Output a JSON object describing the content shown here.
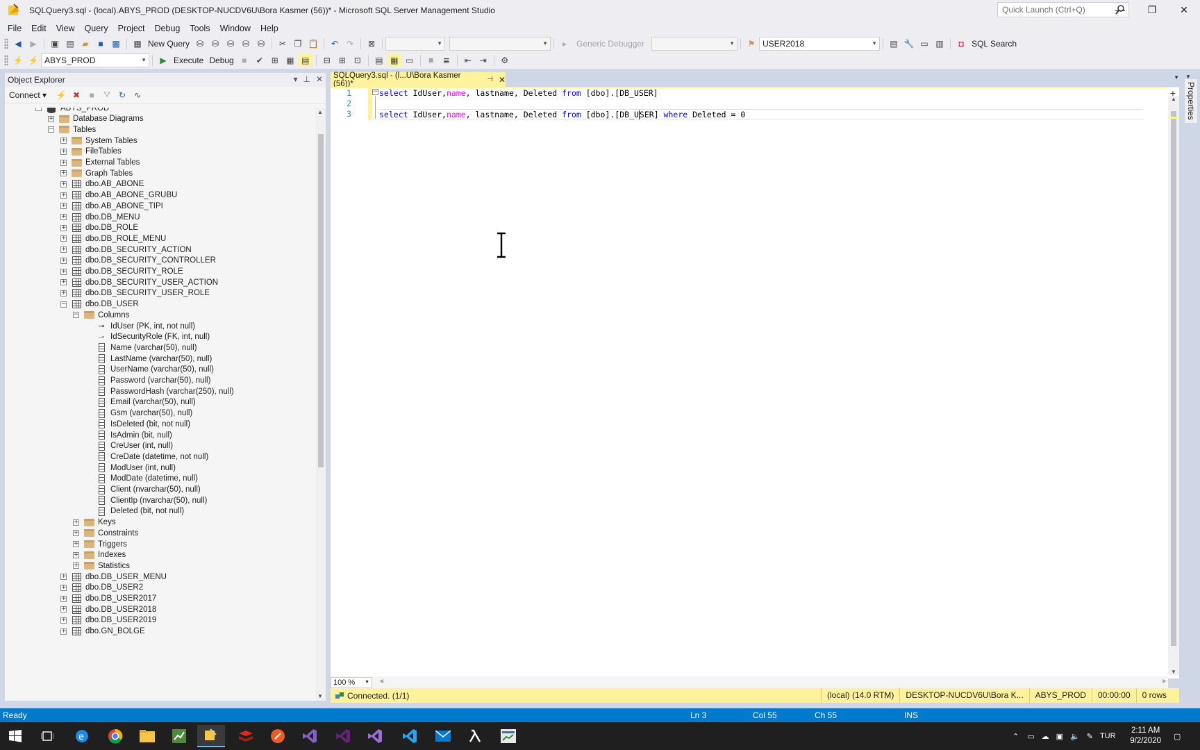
{
  "window": {
    "title": "SQLQuery3.sql - (local).ABYS_PROD (DESKTOP-NUCDV6U\\Bora Kasmer (56))* - Microsoft SQL Server Management Studio",
    "quick_launch_placeholder": "Quick Launch (Ctrl+Q)",
    "minimize": "—",
    "maximize": "❐",
    "close": "✕"
  },
  "menu": [
    "File",
    "Edit",
    "View",
    "Query",
    "Project",
    "Debug",
    "Tools",
    "Window",
    "Help"
  ],
  "toolbar1": {
    "new_query": "New Query",
    "debugger": "Generic Debugger",
    "server_combo": "USER2018",
    "sql_search": "SQL Search"
  },
  "toolbar2": {
    "database": "ABYS_PROD",
    "execute": "Execute",
    "debug": "Debug"
  },
  "object_explorer": {
    "title": "Object Explorer",
    "connect": "Connect",
    "tree": [
      {
        "label": "ABYS_PROD",
        "depth": 2,
        "icon": "database",
        "expander": "-"
      },
      {
        "label": "Database Diagrams",
        "depth": 3,
        "icon": "folder",
        "expander": "+"
      },
      {
        "label": "Tables",
        "depth": 3,
        "icon": "folder",
        "expander": "-"
      },
      {
        "label": "System Tables",
        "depth": 4,
        "icon": "folder",
        "expander": "+"
      },
      {
        "label": "FileTables",
        "depth": 4,
        "icon": "folder",
        "expander": "+"
      },
      {
        "label": "External Tables",
        "depth": 4,
        "icon": "folder",
        "expander": "+"
      },
      {
        "label": "Graph Tables",
        "depth": 4,
        "icon": "folder",
        "expander": "+"
      },
      {
        "label": "dbo.AB_ABONE",
        "depth": 4,
        "icon": "table",
        "expander": "+"
      },
      {
        "label": "dbo.AB_ABONE_GRUBU",
        "depth": 4,
        "icon": "table",
        "expander": "+"
      },
      {
        "label": "dbo.AB_ABONE_TIPI",
        "depth": 4,
        "icon": "table",
        "expander": "+"
      },
      {
        "label": "dbo.DB_MENU",
        "depth": 4,
        "icon": "table",
        "expander": "+"
      },
      {
        "label": "dbo.DB_ROLE",
        "depth": 4,
        "icon": "table",
        "expander": "+"
      },
      {
        "label": "dbo.DB_ROLE_MENU",
        "depth": 4,
        "icon": "table",
        "expander": "+"
      },
      {
        "label": "dbo.DB_SECURITY_ACTION",
        "depth": 4,
        "icon": "table",
        "expander": "+"
      },
      {
        "label": "dbo.DB_SECURITY_CONTROLLER",
        "depth": 4,
        "icon": "table",
        "expander": "+"
      },
      {
        "label": "dbo.DB_SECURITY_ROLE",
        "depth": 4,
        "icon": "table",
        "expander": "+"
      },
      {
        "label": "dbo.DB_SECURITY_USER_ACTION",
        "depth": 4,
        "icon": "table",
        "expander": "+"
      },
      {
        "label": "dbo.DB_SECURITY_USER_ROLE",
        "depth": 4,
        "icon": "table",
        "expander": "+"
      },
      {
        "label": "dbo.DB_USER",
        "depth": 4,
        "icon": "table",
        "expander": "-"
      },
      {
        "label": "Columns",
        "depth": 5,
        "icon": "folder",
        "expander": "-"
      },
      {
        "label": "IdUser (PK, int, not null)",
        "depth": 6,
        "icon": "pk",
        "expander": ""
      },
      {
        "label": "IdSecurityRole (FK, int, null)",
        "depth": 6,
        "icon": "fk",
        "expander": ""
      },
      {
        "label": "Name (varchar(50), null)",
        "depth": 6,
        "icon": "column",
        "expander": ""
      },
      {
        "label": "LastName (varchar(50), null)",
        "depth": 6,
        "icon": "column",
        "expander": ""
      },
      {
        "label": "UserName (varchar(50), null)",
        "depth": 6,
        "icon": "column",
        "expander": ""
      },
      {
        "label": "Password (varchar(50), null)",
        "depth": 6,
        "icon": "column",
        "expander": ""
      },
      {
        "label": "PasswordHash (varchar(250), null)",
        "depth": 6,
        "icon": "column",
        "expander": ""
      },
      {
        "label": "Email (varchar(50), null)",
        "depth": 6,
        "icon": "column",
        "expander": ""
      },
      {
        "label": "Gsm (varchar(50), null)",
        "depth": 6,
        "icon": "column",
        "expander": ""
      },
      {
        "label": "IsDeleted (bit, not null)",
        "depth": 6,
        "icon": "column",
        "expander": ""
      },
      {
        "label": "IsAdmin (bit, null)",
        "depth": 6,
        "icon": "column",
        "expander": ""
      },
      {
        "label": "CreUser (int, null)",
        "depth": 6,
        "icon": "column",
        "expander": ""
      },
      {
        "label": "CreDate (datetime, not null)",
        "depth": 6,
        "icon": "column",
        "expander": ""
      },
      {
        "label": "ModUser (int, null)",
        "depth": 6,
        "icon": "column",
        "expander": ""
      },
      {
        "label": "ModDate (datetime, null)",
        "depth": 6,
        "icon": "column",
        "expander": ""
      },
      {
        "label": "Client (nvarchar(50), null)",
        "depth": 6,
        "icon": "column",
        "expander": ""
      },
      {
        "label": "ClientIp (nvarchar(50), null)",
        "depth": 6,
        "icon": "column",
        "expander": ""
      },
      {
        "label": "Deleted (bit, not null)",
        "depth": 6,
        "icon": "column",
        "expander": ""
      },
      {
        "label": "Keys",
        "depth": 5,
        "icon": "folder",
        "expander": "+"
      },
      {
        "label": "Constraints",
        "depth": 5,
        "icon": "folder",
        "expander": "+"
      },
      {
        "label": "Triggers",
        "depth": 5,
        "icon": "folder",
        "expander": "+"
      },
      {
        "label": "Indexes",
        "depth": 5,
        "icon": "folder",
        "expander": "+"
      },
      {
        "label": "Statistics",
        "depth": 5,
        "icon": "folder",
        "expander": "+"
      },
      {
        "label": "dbo.DB_USER_MENU",
        "depth": 4,
        "icon": "table",
        "expander": "+"
      },
      {
        "label": "dbo.DB_USER2",
        "depth": 4,
        "icon": "table",
        "expander": "+"
      },
      {
        "label": "dbo.DB_USER2017",
        "depth": 4,
        "icon": "table",
        "expander": "+"
      },
      {
        "label": "dbo.DB_USER2018",
        "depth": 4,
        "icon": "table",
        "expander": "+"
      },
      {
        "label": "dbo.DB_USER2019",
        "depth": 4,
        "icon": "table",
        "expander": "+"
      },
      {
        "label": "dbo.GN_BOLGE",
        "depth": 4,
        "icon": "table",
        "expander": "+"
      }
    ]
  },
  "document_tab": {
    "label": "SQLQuery3.sql - (l...U\\Bora Kasmer (56))*"
  },
  "editor": {
    "line_numbers": [
      "1",
      "2",
      "3"
    ],
    "line1": {
      "kw1": "select",
      "cols": " IdUser,",
      "name": "name",
      "rest": ", lastname, Deleted ",
      "kw2": "from",
      "table": " [dbo].[DB_USER]"
    },
    "line3": {
      "kw1": "select",
      "cols": " IdUser,",
      "name": "name",
      "rest": ", lastname, Deleted ",
      "kw2": "from",
      "table_a": " [dbo].[DB_U",
      "table_b": "SER] ",
      "kw3": "where",
      "cond": " Deleted = 0"
    },
    "zoom": "100 %"
  },
  "query_status": {
    "connected": "Connected. (1/1)",
    "server": "(local) (14.0 RTM)",
    "user": "DESKTOP-NUCDV6U\\Bora K...",
    "database": "ABYS_PROD",
    "elapsed": "00:00:00",
    "rows": "0 rows"
  },
  "properties_label": "Properties",
  "status_bar": {
    "ready": "Ready",
    "ln": "Ln 3",
    "col": "Col 55",
    "ch": "Ch 55",
    "ins": "INS"
  },
  "taskbar": {
    "lang": "TUR",
    "time": "2:11 AM",
    "date": "9/2/2020"
  },
  "colors": {
    "accent": "#007acc",
    "tab_yellow": "#fff29d",
    "keyword_blue": "#0000ff",
    "function_pink": "#ff00ff",
    "line_number": "#2b91af"
  }
}
